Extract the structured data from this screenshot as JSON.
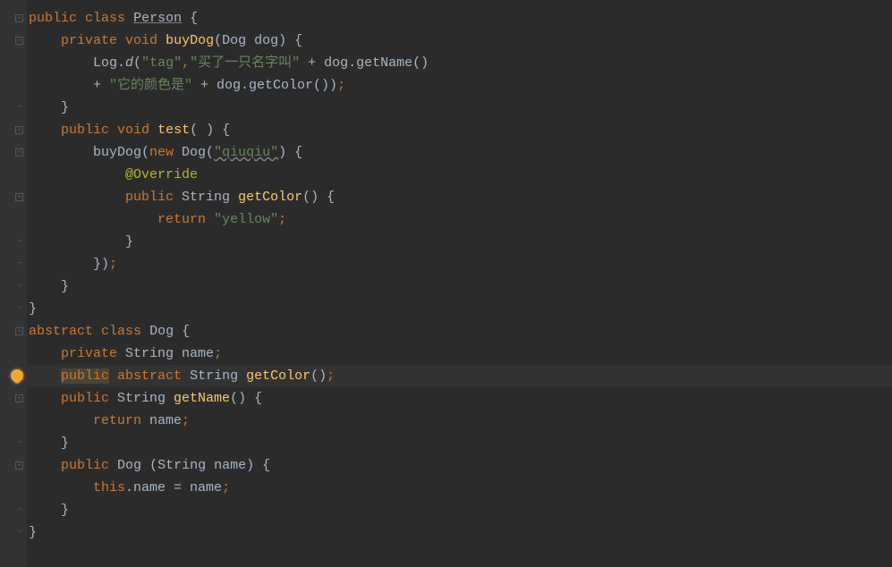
{
  "code": {
    "tokens": [
      [
        [
          "kw",
          "public"
        ],
        [
          "",
          " "
        ],
        [
          "kw",
          "class"
        ],
        [
          "",
          " "
        ],
        [
          "underl",
          "Person"
        ],
        [
          "",
          " {"
        ]
      ],
      [
        [
          "",
          "    "
        ],
        [
          "kw",
          "private"
        ],
        [
          "",
          " "
        ],
        [
          "kw",
          "void"
        ],
        [
          "",
          " "
        ],
        [
          "mth",
          "buyDog"
        ],
        [
          "",
          "(Dog dog) {"
        ]
      ],
      [
        [
          "",
          "        Log."
        ],
        [
          "ital",
          "d"
        ],
        [
          "",
          "("
        ],
        [
          "str",
          "\"tag\""
        ],
        [
          "pun",
          ","
        ],
        [
          "str",
          "\"买了一只名字叫\""
        ],
        [
          "",
          " + dog.getName()"
        ]
      ],
      [
        [
          "",
          "        + "
        ],
        [
          "str",
          "\"它的颜色是\""
        ],
        [
          "",
          " + dog.getColor())"
        ],
        [
          "pun",
          ";"
        ]
      ],
      [
        [
          "",
          "    }"
        ]
      ],
      [
        [
          "",
          "    "
        ],
        [
          "kw",
          "public"
        ],
        [
          "",
          " "
        ],
        [
          "kw",
          "void"
        ],
        [
          "",
          " "
        ],
        [
          "mth",
          "test"
        ],
        [
          "",
          "( ) {"
        ]
      ],
      [
        [
          "",
          "        buyDog("
        ],
        [
          "kw",
          "new"
        ],
        [
          "",
          " Dog("
        ],
        [
          "str wave",
          "\"qiuqiu\""
        ],
        [
          "",
          ") {"
        ]
      ],
      [
        [
          "",
          "            "
        ],
        [
          "ann",
          "@Override"
        ]
      ],
      [
        [
          "",
          "            "
        ],
        [
          "kw",
          "public"
        ],
        [
          "",
          " String "
        ],
        [
          "mth",
          "getColor"
        ],
        [
          "",
          "() {"
        ]
      ],
      [
        [
          "",
          "                "
        ],
        [
          "kw",
          "return"
        ],
        [
          "",
          " "
        ],
        [
          "str",
          "\"yellow\""
        ],
        [
          "pun",
          ";"
        ]
      ],
      [
        [
          "",
          "            }"
        ]
      ],
      [
        [
          "",
          "        })"
        ],
        [
          "pun",
          ";"
        ]
      ],
      [
        [
          "",
          "    }"
        ]
      ],
      [
        [
          "",
          "}"
        ]
      ],
      [
        [
          "kw",
          "abstract"
        ],
        [
          "",
          " "
        ],
        [
          "kw",
          "class"
        ],
        [
          "",
          " "
        ],
        [
          "cls",
          "Dog"
        ],
        [
          "",
          " {"
        ]
      ],
      [
        [
          "",
          "    "
        ],
        [
          "kw",
          "private"
        ],
        [
          "",
          " String name"
        ],
        [
          "pun",
          ";"
        ]
      ],
      [
        [
          "",
          "    "
        ],
        [
          "kw khl",
          "public"
        ],
        [
          "",
          " "
        ],
        [
          "kw",
          "abstract"
        ],
        [
          "",
          " String "
        ],
        [
          "mth",
          "getColor"
        ],
        [
          "",
          "()"
        ],
        [
          "pun",
          ";"
        ]
      ],
      [
        [
          "",
          "    "
        ],
        [
          "kw",
          "public"
        ],
        [
          "",
          " String "
        ],
        [
          "mth",
          "getName"
        ],
        [
          "",
          "() {"
        ]
      ],
      [
        [
          "",
          "        "
        ],
        [
          "kw",
          "return"
        ],
        [
          "",
          " name"
        ],
        [
          "pun",
          ";"
        ]
      ],
      [
        [
          "",
          "    }"
        ]
      ],
      [
        [
          "",
          "    "
        ],
        [
          "kw",
          "public"
        ],
        [
          "",
          " "
        ],
        [
          "cls",
          "Dog"
        ],
        [
          "",
          " (String name) {"
        ]
      ],
      [
        [
          "",
          "        "
        ],
        [
          "kw",
          "this"
        ],
        [
          "",
          ".name = name"
        ],
        [
          "pun",
          ";"
        ]
      ],
      [
        [
          "",
          "    }"
        ]
      ],
      [
        [
          "",
          "}"
        ]
      ]
    ],
    "highlight_line": 16,
    "bulb_line": 16
  },
  "gutter": {
    "fold_markers": [
      0,
      1,
      5,
      6,
      8,
      14,
      16,
      17,
      20
    ],
    "close_markers": [
      4,
      10,
      11,
      12,
      13,
      19,
      22,
      23
    ]
  }
}
